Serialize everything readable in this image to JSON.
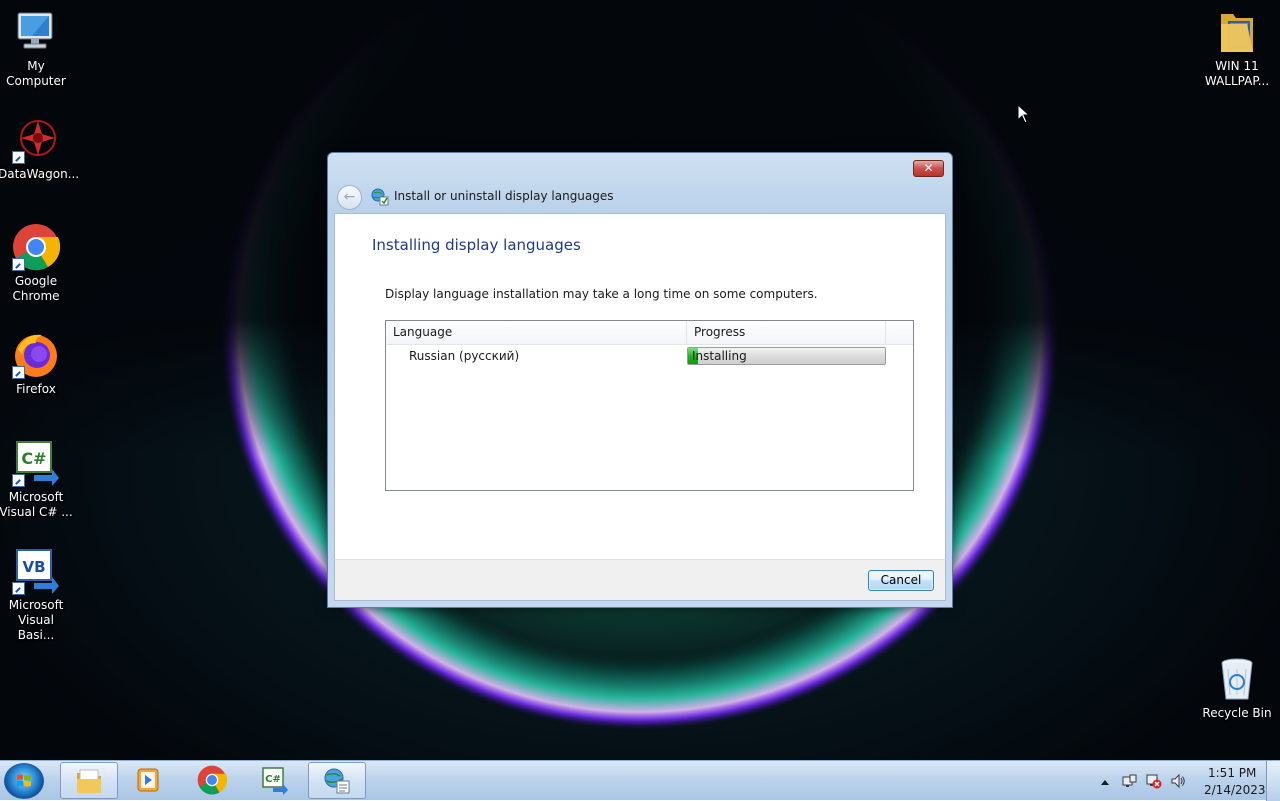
{
  "desktop": {
    "icons": [
      {
        "label": "My\nComputer",
        "icon": "computer-icon"
      },
      {
        "label": "DataWagon...",
        "icon": "datawagon-icon"
      },
      {
        "label": "Google\nChrome",
        "icon": "chrome-icon"
      },
      {
        "label": "Firefox",
        "icon": "firefox-icon"
      },
      {
        "label": "Microsoft\nVisual C# ...",
        "icon": "visual-csharp-icon"
      },
      {
        "label": "Microsoft\nVisual Basi...",
        "icon": "visual-basic-icon"
      },
      {
        "label": "WIN 11\nWALLPAP...",
        "icon": "folder-icon"
      },
      {
        "label": "Recycle Bin",
        "icon": "recycle-bin-icon"
      }
    ]
  },
  "dialog": {
    "close_label": "✕",
    "title": "Install or uninstall display languages",
    "heading": "Installing display languages",
    "info": "Display language installation may take a long time on some computers.",
    "columns": {
      "language": "Language",
      "progress": "Progress"
    },
    "rows": [
      {
        "language": "Russian (русский)",
        "status": "Installing",
        "progress": 0.05
      }
    ],
    "cancel_label": "Cancel"
  },
  "taskbar": {
    "items": [
      {
        "icon": "file-explorer-icon",
        "active": true
      },
      {
        "icon": "media-player-icon",
        "active": false
      },
      {
        "icon": "chrome-icon",
        "active": false
      },
      {
        "icon": "visual-csharp-icon",
        "active": false
      },
      {
        "icon": "language-settings-icon",
        "active": true
      }
    ],
    "clock": {
      "time": "1:51 PM",
      "date": "2/14/2023"
    }
  },
  "colors": {
    "heading": "#1e3a8a",
    "progress_green": "#21b521",
    "cancel_border": "#3c7fb1"
  }
}
